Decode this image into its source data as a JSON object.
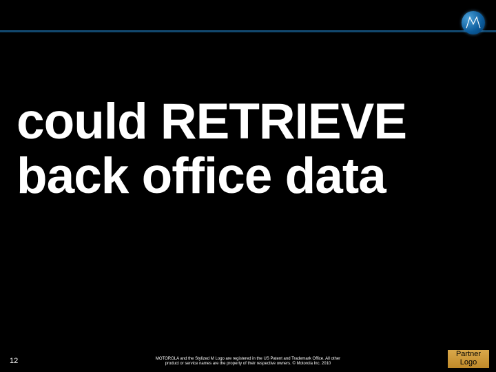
{
  "slide": {
    "main_text": "could RETRIEVE back office data",
    "page_number": "12",
    "footer_line1": "MOTOROLA and the Stylized M Logo are registered in the US Patent and Trademark Office. All other",
    "footer_line2": "product or service names are the property of their respective owners. © Motorola Inc. 2010",
    "partner_logo_line1": "Partner",
    "partner_logo_line2": "Logo"
  },
  "logo": {
    "name": "motorola-m-logo"
  },
  "colors": {
    "background": "#000000",
    "divider": "#1a5a8a",
    "logo_accent": "#0a5a9a",
    "partner_bg": "#c9922f",
    "text": "#ffffff"
  }
}
